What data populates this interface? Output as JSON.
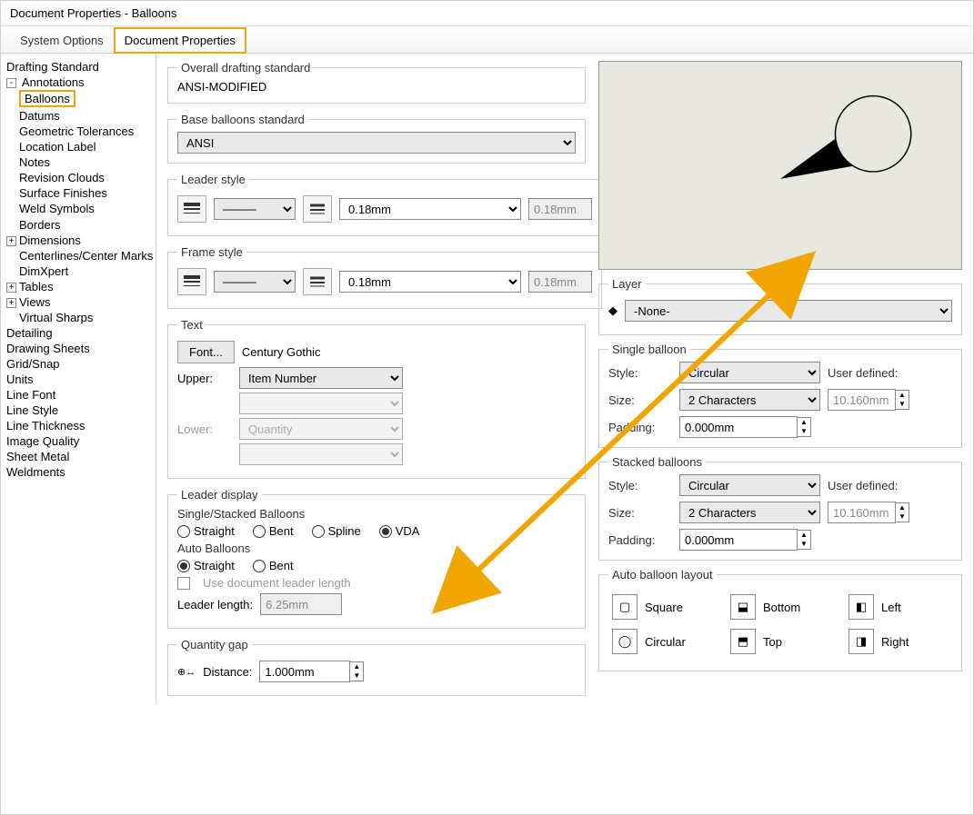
{
  "window": {
    "title": "Document Properties - Balloons"
  },
  "tabs": {
    "system": "System Options",
    "doc": "Document Properties"
  },
  "tree": {
    "drafting_standard": "Drafting Standard",
    "annotations": "Annotations",
    "balloons": "Balloons",
    "datums": "Datums",
    "geotol": "Geometric Tolerances",
    "loclabel": "Location Label",
    "notes": "Notes",
    "revclouds": "Revision Clouds",
    "surfin": "Surface Finishes",
    "weld": "Weld Symbols",
    "borders": "Borders",
    "dimensions": "Dimensions",
    "centerlines": "Centerlines/Center Marks",
    "dimxpert": "DimXpert",
    "tables": "Tables",
    "views": "Views",
    "virtsharps": "Virtual Sharps",
    "detailing": "Detailing",
    "drawingsheets": "Drawing Sheets",
    "gridsnap": "Grid/Snap",
    "units": "Units",
    "linefont": "Line Font",
    "linestyle": "Line Style",
    "linethick": "Line Thickness",
    "imgqual": "Image Quality",
    "sheetmetal": "Sheet Metal",
    "weldments": "Weldments"
  },
  "overall": {
    "legend": "Overall drafting standard",
    "value": "ANSI-MODIFIED"
  },
  "base": {
    "legend": "Base balloons standard",
    "value": "ANSI"
  },
  "leader_style": {
    "legend": "Leader style",
    "thickness": "0.18mm",
    "field": "0.18mm"
  },
  "frame_style": {
    "legend": "Frame style",
    "thickness": "0.18mm",
    "field": "0.18mm"
  },
  "text": {
    "legend": "Text",
    "font_btn": "Font...",
    "font_name": "Century Gothic",
    "upper_lbl": "Upper:",
    "upper_val": "Item Number",
    "lower_lbl": "Lower:",
    "lower_val": "Quantity"
  },
  "leader_display": {
    "legend": "Leader display",
    "single_stacked": "Single/Stacked Balloons",
    "straight": "Straight",
    "bent": "Bent",
    "spline": "Spline",
    "vda": "VDA",
    "auto": "Auto Balloons",
    "use_doc": "Use document leader length",
    "leader_len_lbl": "Leader length:",
    "leader_len_val": "6.25mm"
  },
  "quantity_gap": {
    "legend": "Quantity gap",
    "distance_lbl": "Distance:",
    "distance_val": "1.000mm"
  },
  "layer": {
    "legend": "Layer",
    "value": "-None-"
  },
  "single_balloon": {
    "legend": "Single balloon",
    "style_lbl": "Style:",
    "style_val": "Circular",
    "size_lbl": "Size:",
    "size_val": "2 Characters",
    "pad_lbl": "Padding:",
    "pad_val": "0.000mm",
    "user_lbl": "User defined:",
    "user_val": "10.160mm"
  },
  "stacked_balloons": {
    "legend": "Stacked balloons",
    "style_lbl": "Style:",
    "style_val": "Circular",
    "size_lbl": "Size:",
    "size_val": "2 Characters",
    "pad_lbl": "Padding:",
    "pad_val": "0.000mm",
    "user_lbl": "User defined:",
    "user_val": "10.160mm"
  },
  "auto_layout": {
    "legend": "Auto balloon layout",
    "square": "Square",
    "bottom": "Bottom",
    "left": "Left",
    "circular": "Circular",
    "top": "Top",
    "right": "Right"
  }
}
